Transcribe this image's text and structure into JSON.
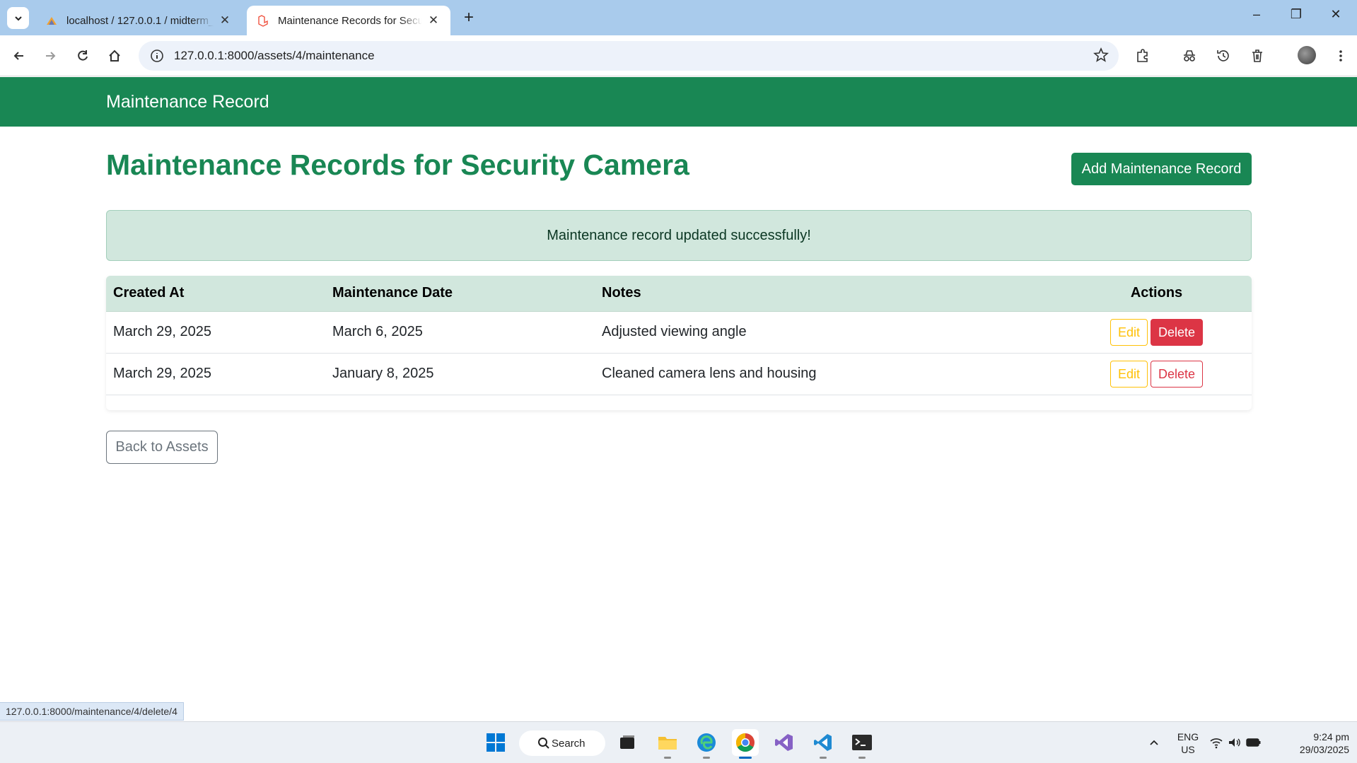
{
  "browser": {
    "tabs": [
      {
        "title": "localhost / 127.0.0.1 / midterm_",
        "active": false
      },
      {
        "title": "Maintenance Records for Security Camera",
        "active": true
      }
    ],
    "url": "127.0.0.1:8000/assets/4/maintenance",
    "status_url": "127.0.0.1:8000/maintenance/4/delete/4"
  },
  "navbar": {
    "brand": "Maintenance Record"
  },
  "page": {
    "title": "Maintenance Records for Security Camera",
    "add_button": "Add Maintenance Record",
    "alert": "Maintenance record updated successfully!",
    "back_button": "Back to Assets"
  },
  "table": {
    "headers": {
      "created_at": "Created At",
      "maintenance_date": "Maintenance Date",
      "notes": "Notes",
      "actions": "Actions"
    },
    "rows": [
      {
        "created_at": "March 29, 2025",
        "maintenance_date": "March 6, 2025",
        "notes": "Adjusted viewing angle",
        "edit": "Edit",
        "delete": "Delete"
      },
      {
        "created_at": "March 29, 2025",
        "maintenance_date": "January 8, 2025",
        "notes": "Cleaned camera lens and housing",
        "edit": "Edit",
        "delete": "Delete"
      }
    ]
  },
  "taskbar": {
    "search": "Search",
    "lang": "ENG",
    "region": "US",
    "time": "9:24 pm",
    "date": "29/03/2025"
  },
  "colors": {
    "primary_green": "#198754",
    "alert_bg": "#d1e7dd",
    "danger": "#dc3545",
    "warning": "#ffc107"
  }
}
